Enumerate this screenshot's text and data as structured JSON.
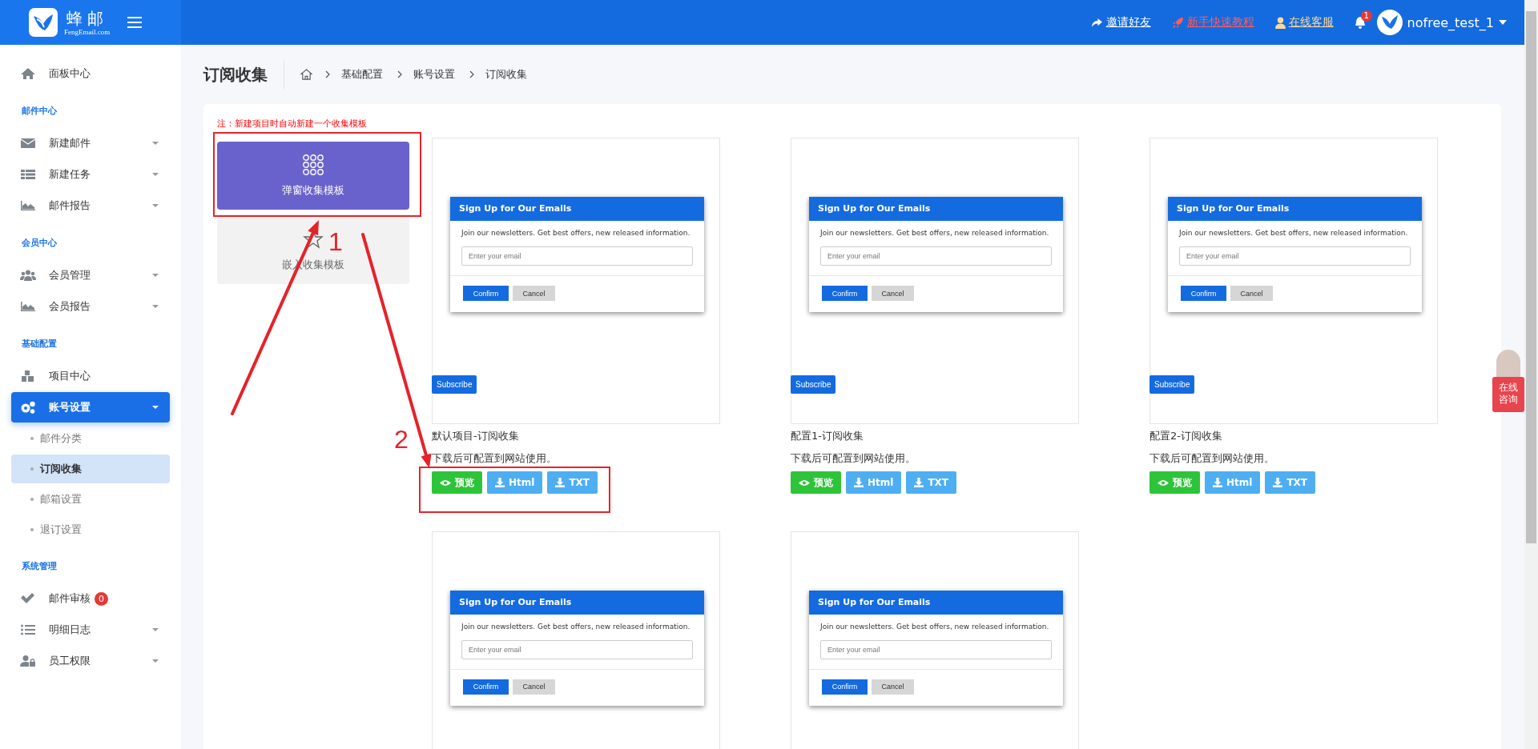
{
  "header": {
    "logo_title": "蜂邮",
    "logo_subtitle": "FengEmail.com",
    "links": [
      {
        "label": "邀请好友",
        "color": "#ffffff"
      },
      {
        "label": "新手快速教程",
        "color": "#ff5c5c"
      },
      {
        "label": "在线客服",
        "color": "#f6d9a2"
      }
    ],
    "notification_count": "1",
    "username": "nofree_test_1"
  },
  "sidebar": {
    "items": [
      {
        "kind": "item",
        "label": "面板中心",
        "has_caret": false,
        "selected": false
      },
      {
        "kind": "heading",
        "label": "邮件中心"
      },
      {
        "kind": "item",
        "label": "新建邮件",
        "has_caret": true,
        "selected": false
      },
      {
        "kind": "item",
        "label": "新建任务",
        "has_caret": true,
        "selected": false
      },
      {
        "kind": "item",
        "label": "邮件报告",
        "has_caret": true,
        "selected": false
      },
      {
        "kind": "heading",
        "label": "会员中心"
      },
      {
        "kind": "item",
        "label": "会员管理",
        "has_caret": true,
        "selected": false
      },
      {
        "kind": "item",
        "label": "会员报告",
        "has_caret": true,
        "selected": false
      },
      {
        "kind": "heading",
        "label": "基础配置"
      },
      {
        "kind": "item",
        "label": "项目中心",
        "has_caret": false,
        "selected": false
      },
      {
        "kind": "item",
        "label": "账号设置",
        "has_caret": true,
        "selected": true
      },
      {
        "kind": "subitem",
        "label": "邮件分类",
        "selected": false
      },
      {
        "kind": "subitem",
        "label": "订阅收集",
        "selected": true
      },
      {
        "kind": "subitem",
        "label": "邮箱设置",
        "selected": false
      },
      {
        "kind": "subitem",
        "label": "退订设置",
        "selected": false
      },
      {
        "kind": "heading",
        "label": "系统管理"
      },
      {
        "kind": "item",
        "label": "邮件审核",
        "has_caret": false,
        "selected": false,
        "badge": "0"
      },
      {
        "kind": "item",
        "label": "明细日志",
        "has_caret": true,
        "selected": false
      },
      {
        "kind": "item",
        "label": "员工权限",
        "has_caret": true,
        "selected": false
      }
    ]
  },
  "page_title": "订阅收集",
  "breadcrumb": [
    "基础配置",
    "账号设置",
    "订阅收集"
  ],
  "note": "注：新建项目时自动新建一个收集模板",
  "template_types": [
    {
      "label": "弹窗收集模板",
      "selected": true
    },
    {
      "label": "嵌入收集模板",
      "selected": false
    }
  ],
  "templates": [
    {
      "popup": {
        "heading": "Sign Up for Our Emails",
        "text": "Join our newsletters. Get best offers, new released information.",
        "placeholder": "Enter your email",
        "confirm": "Confirm",
        "cancel": "Cancel"
      },
      "subscribe": "Subscribe",
      "title": "默认项目-订阅收集",
      "description": "下载后可配置到网站使用。",
      "buttons": [
        {
          "label": "预览",
          "kind": "preview"
        },
        {
          "label": "Html",
          "kind": "download"
        },
        {
          "label": "TXT",
          "kind": "download"
        }
      ]
    },
    {
      "popup": {
        "heading": "Sign Up for Our Emails",
        "text": "Join our newsletters. Get best offers, new released information.",
        "placeholder": "Enter your email",
        "confirm": "Confirm",
        "cancel": "Cancel"
      },
      "subscribe": "Subscribe",
      "title": "配置1-订阅收集",
      "description": "下载后可配置到网站使用。",
      "buttons": [
        {
          "label": "预览",
          "kind": "preview"
        },
        {
          "label": "Html",
          "kind": "download"
        },
        {
          "label": "TXT",
          "kind": "download"
        }
      ]
    },
    {
      "popup": {
        "heading": "Sign Up for Our Emails",
        "text": "Join our newsletters. Get best offers, new released information.",
        "placeholder": "Enter your email",
        "confirm": "Confirm",
        "cancel": "Cancel"
      },
      "subscribe": "Subscribe",
      "title": "配置2-订阅收集",
      "description": "下载后可配置到网站使用。",
      "buttons": [
        {
          "label": "预览",
          "kind": "preview"
        },
        {
          "label": "Html",
          "kind": "download"
        },
        {
          "label": "TXT",
          "kind": "download"
        }
      ]
    },
    {
      "popup": {
        "heading": "Sign Up for Our Emails",
        "text": "Join our newsletters. Get best offers, new released information.",
        "placeholder": "Enter your email",
        "confirm": "Confirm",
        "cancel": "Cancel"
      }
    },
    {
      "popup": {
        "heading": "Sign Up for Our Emails",
        "text": "Join our newsletters. Get best offers, new released information.",
        "placeholder": "Enter your email",
        "confirm": "Confirm",
        "cancel": "Cancel"
      }
    }
  ],
  "chat_widget": {
    "label": "在线咨询"
  },
  "annotation_labels": [
    "1",
    "2"
  ]
}
